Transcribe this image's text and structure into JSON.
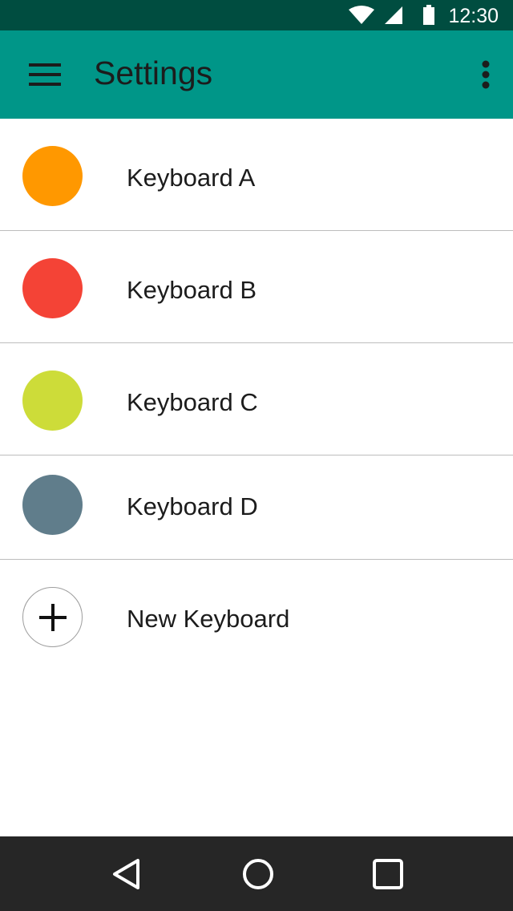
{
  "status_bar": {
    "time": "12:30",
    "icons": [
      "wifi-icon",
      "cell-signal-icon",
      "battery-icon"
    ],
    "background": "#004d40"
  },
  "app_bar": {
    "title": "Settings",
    "menu_icon": "hamburger-menu-icon",
    "overflow_icon": "more-vertical-icon",
    "background": "#009688"
  },
  "keyboards": [
    {
      "label": "Keyboard A",
      "color": "#ff9800"
    },
    {
      "label": "Keyboard B",
      "color": "#f44336"
    },
    {
      "label": "Keyboard C",
      "color": "#cddc39"
    },
    {
      "label": "Keyboard D",
      "color": "#607d8b"
    }
  ],
  "new_keyboard": {
    "label": "New Keyboard",
    "icon": "plus-icon"
  },
  "nav_bar": {
    "icons": [
      "back-icon",
      "home-icon",
      "recents-icon"
    ],
    "background": "#262626"
  }
}
